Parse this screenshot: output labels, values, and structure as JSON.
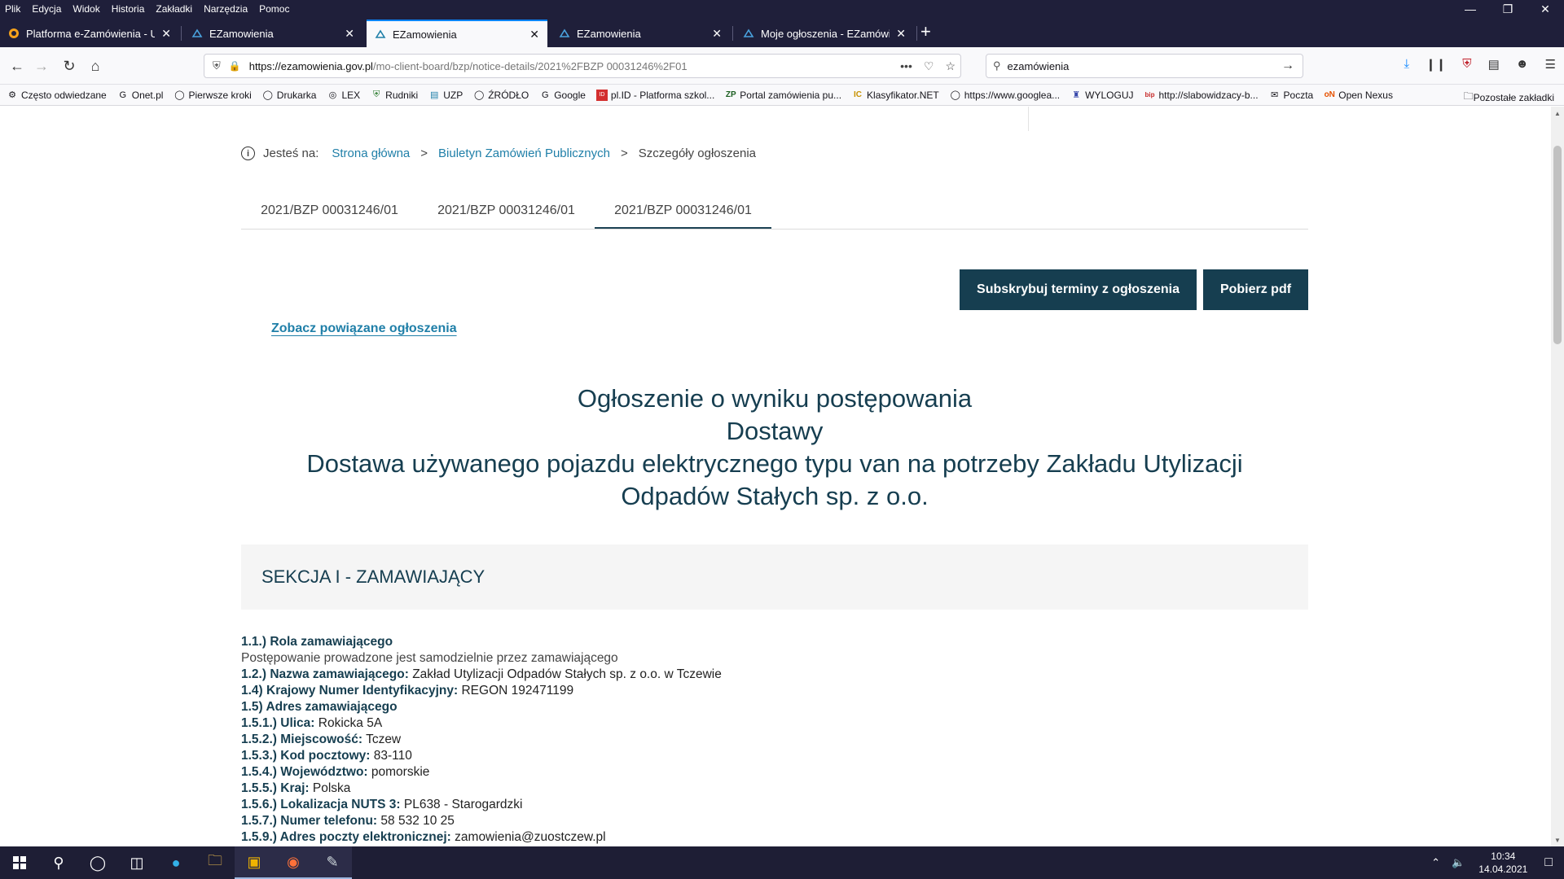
{
  "browser": {
    "menu": [
      "Plik",
      "Edycja",
      "Widok",
      "Historia",
      "Zakładki",
      "Narzędzia",
      "Pomoc"
    ],
    "tabs": [
      {
        "title": "Platforma e-Zamówienia - Urz",
        "icon": "orange-globe-icon"
      },
      {
        "title": "EZamowienia",
        "icon": "ezamowienia-icon"
      },
      {
        "title": "EZamowienia",
        "icon": "ezamowienia-icon",
        "active": true
      },
      {
        "title": "EZamowienia",
        "icon": "ezamowienia-icon"
      },
      {
        "title": "Moje ogłoszenia - EZamówienia",
        "icon": "ezamowienia-icon"
      }
    ],
    "url_host": "https://ezamowienia.gov.pl",
    "url_path": "/mo-client-board/bzp/notice-details/2021%2FBZP 00031246%2F01",
    "search_value": "ezamówienia",
    "bookmarks": [
      "Często odwiedzane",
      "Onet.pl",
      "Pierwsze kroki",
      "Drukarka",
      "LEX",
      "Rudniki",
      "UZP",
      "ŹRÓDŁO",
      "Google",
      "pl.ID - Platforma szkol...",
      "Portal zamówienia pu...",
      "Klasyfikator.NET",
      "https://www.googlea...",
      "WYLOGUJ",
      "http://slabowidzacy-b...",
      "Poczta",
      "Open Nexus"
    ],
    "bookmarks_other": "Pozostałe zakładki"
  },
  "breadcrumb": {
    "label": "Jesteś na:",
    "home": "Strona główna",
    "bzp": "Biuletyn Zamówień Publicznych",
    "current": "Szczegóły ogłoszenia",
    "separator": ">"
  },
  "doc_tabs": [
    "2021/BZP 00031246/01",
    "2021/BZP 00031246/01",
    "2021/BZP 00031246/01"
  ],
  "actions": {
    "subscribe": "Subskrybuj terminy z ogłoszenia",
    "pdf": "Pobierz pdf",
    "related": "Zobacz powiązane ogłoszenia"
  },
  "notice": {
    "title_line1": "Ogłoszenie o wyniku postępowania",
    "title_line2": "Dostawy",
    "title_line3": "Dostawa używanego pojazdu elektrycznego typu van na potrzeby Zakładu Utylizacji",
    "title_line4": "Odpadów Stałych sp. z o.o."
  },
  "section1": {
    "header": "SEKCJA I - ZAMAWIAJĄCY",
    "role_label": "1.1.) Rola zamawiającego",
    "role_value": "Postępowanie prowadzone jest samodzielnie przez zamawiającego",
    "fields": [
      {
        "k": "1.2.) Nazwa zamawiającego:",
        "v": "Zakład Utylizacji Odpadów Stałych sp. z o.o. w Tczewie"
      },
      {
        "k": "1.4) Krajowy Numer Identyfikacyjny:",
        "v": "REGON 192471199"
      },
      {
        "k": "1.5) Adres zamawiającego",
        "v": ""
      },
      {
        "k": "1.5.1.) Ulica:",
        "v": "Rokicka 5A"
      },
      {
        "k": "1.5.2.) Miejscowość:",
        "v": "Tczew"
      },
      {
        "k": "1.5.3.) Kod pocztowy:",
        "v": "83-110"
      },
      {
        "k": "1.5.4.) Województwo:",
        "v": "pomorskie"
      },
      {
        "k": "1.5.5.) Kraj:",
        "v": "Polska"
      },
      {
        "k": "1.5.6.) Lokalizacja NUTS 3:",
        "v": "PL638 - Starogardzki"
      },
      {
        "k": "1.5.7.) Numer telefonu:",
        "v": "58 532 10 25"
      },
      {
        "k": "1.5.9.) Adres poczty elektronicznej:",
        "v": "zamowienia@zuostczew.pl"
      }
    ]
  },
  "taskbar": {
    "time": "10:34",
    "date": "14.04.2021"
  },
  "colors": {
    "primary": "#163e50",
    "link": "#1f7fa8",
    "chrome_dark": "#1f1f3a"
  }
}
